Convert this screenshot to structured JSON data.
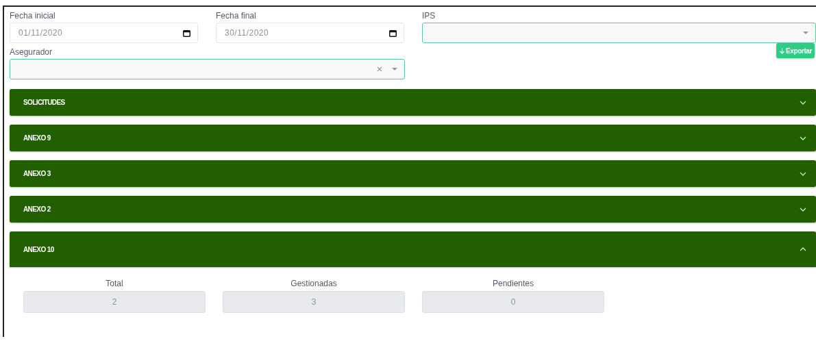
{
  "filters_row_1": [
    {
      "kind": "date",
      "label": "Fecha inicial",
      "value": "01/11/2020"
    },
    {
      "kind": "date",
      "label": "Fecha final",
      "value": "30/11/2020"
    },
    {
      "kind": "select",
      "label": "IPS"
    }
  ],
  "filters_row_2": {
    "field": {
      "kind": "select",
      "label": "Asegurador",
      "clearable": true
    },
    "export_button": "Exportar"
  },
  "panels": [
    {
      "title": "SOLICITUDES",
      "expanded": false
    },
    {
      "title": "ANEXO 9",
      "expanded": false
    },
    {
      "title": "ANEXO 3",
      "expanded": false
    },
    {
      "title": "ANEXO 2",
      "expanded": false
    },
    {
      "title": "ANEXO 10",
      "expanded": true,
      "stats": [
        {
          "label": "Total",
          "value": "2"
        },
        {
          "label": "Gestionadas",
          "value": "3"
        },
        {
          "label": "Pendientes",
          "value": "0"
        }
      ]
    }
  ]
}
